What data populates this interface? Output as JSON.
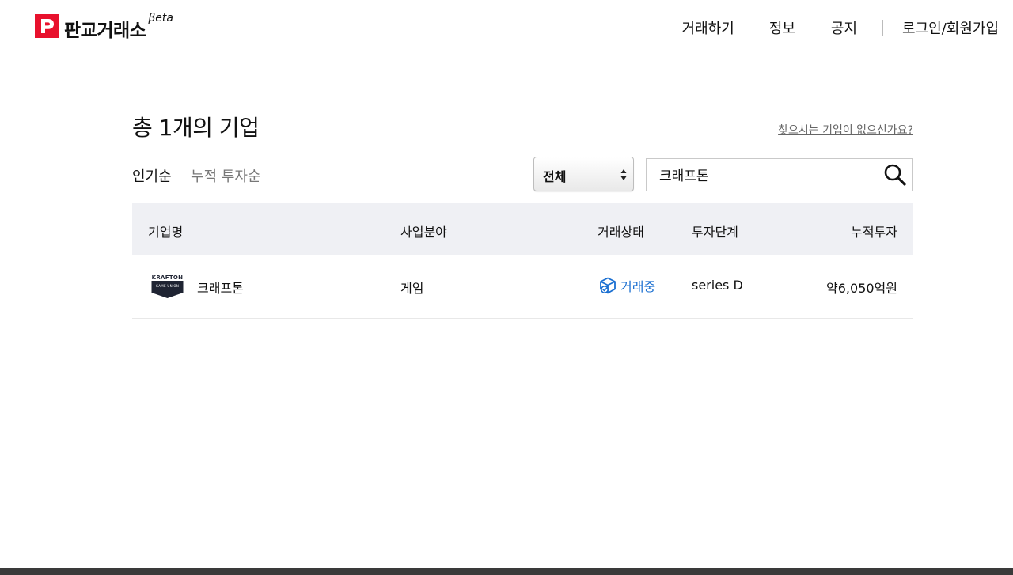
{
  "header": {
    "logo_text": "판교거래소",
    "logo_beta": "βeta",
    "nav": {
      "trade": "거래하기",
      "info": "정보",
      "notice": "공지",
      "login": "로그인/회원가입"
    }
  },
  "main": {
    "title": "총 1개의 기업",
    "missing_link": "찾으시는 기업이 없으신가요?",
    "sort": {
      "popular": "인기순",
      "invest": "누적 투자순"
    },
    "filter_select": {
      "value": "전체"
    },
    "search": {
      "value": "크래프톤"
    }
  },
  "table": {
    "headers": {
      "name": "기업명",
      "field": "사업분야",
      "status": "거래상태",
      "stage": "투자단계",
      "amount": "누적투자"
    },
    "rows": [
      {
        "logo_text_top": "KRAFTON",
        "logo_text_bottom": "GAME UNION",
        "name": "크래프톤",
        "field": "게임",
        "status": "거래중",
        "stage": "series D",
        "amount": "약6,050억원"
      }
    ]
  },
  "colors": {
    "brand": "#e8112d",
    "status": "#1a6fd1",
    "table_header_bg": "#eff0f4"
  },
  "icons": [
    "logo-mark-icon",
    "sort-arrows-icon",
    "search-icon",
    "trade-status-box-icon",
    "krafton-logo"
  ]
}
